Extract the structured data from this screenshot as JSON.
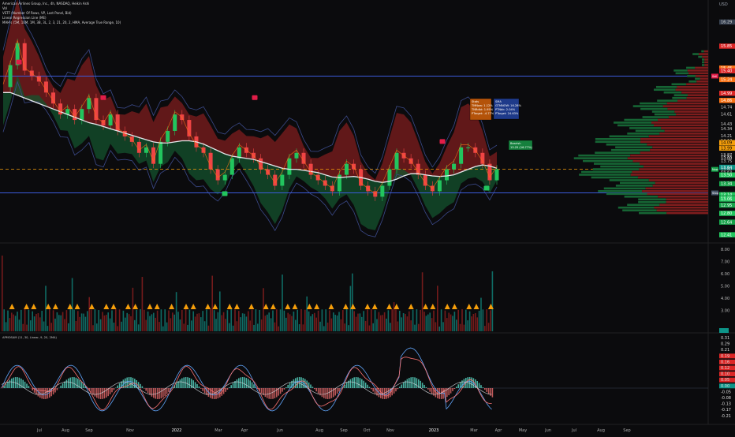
{
  "legend": {
    "title": "American Airlines Group, Inc., 4h, NASDAQ, Heikin Ashi",
    "line2": "Vol",
    "line3": "VSTF (Number Of Rows, VP, Last Panel, Bid)",
    "line4": "Linear Regression Line (ME)",
    "line5": "MAH's (5M, 10M, 1M, 3B, 3L, 2, 3, 21, 20, 2, HMA, Average True Range, 10)"
  },
  "currency": "USD",
  "colors": {
    "background": "#0b0b0d",
    "up": "#22c55e",
    "down": "#ef4444",
    "cloud_red": "#7f1d1d",
    "cloud_green": "#14532d",
    "price_marker": "#f59e0b",
    "level_line": "#3b5bdb",
    "wma": "#e5e7eb",
    "triangle": "#f59e0b",
    "osc_blue": "#60a5fa",
    "osc_red": "#f87171",
    "osc_white": "#d1d5db"
  },
  "annotations": {
    "box1": [
      "Stats",
      "TMNow: 1.12%",
      "TNRdbt: 1.95%",
      "PTarget: -4.77%"
    ],
    "box2": [
      "SMA",
      "GTMNOW: 16.28%",
      "PTNbk: 2.04%",
      "PTarget: 24.63%"
    ],
    "box3": [
      "Bearish",
      "13.25 (16.77%)"
    ],
    "sig_label": "Sell"
  },
  "volume_panel": {
    "labels": [
      "8.00",
      "7.00",
      "6.00",
      "5.00",
      "4.00",
      "3.00"
    ]
  },
  "osc_panel": {
    "title": "APMOSAM (11, 30, Linear, 9, 20, 2MA)"
  },
  "chart_data": {
    "type": "line",
    "title": "American Airlines Group, Inc., 4h, NASDAQ, Heikin Ashi",
    "x_ticks": [
      "Jul",
      "Aug",
      "Sep",
      "Nov",
      "2022",
      "Mar",
      "Apr",
      "Jun",
      "Aug",
      "Sep",
      "Oct",
      "Nov",
      "2023",
      "Mar",
      "Apr",
      "May",
      "Jun",
      "Jul",
      "Aug",
      "Sep"
    ],
    "x_months_index": [
      0,
      1,
      2,
      4,
      6,
      8,
      9,
      11,
      13,
      14,
      15,
      16,
      18,
      20,
      21,
      22,
      23,
      24,
      25,
      26
    ],
    "y_axis_labels": [
      "16.29",
      "15.85",
      "15.45",
      "15.40",
      "15.24",
      "14.99",
      "14.86",
      "14.74",
      "14.61",
      "14.43",
      "14.34",
      "14.21",
      "14.13",
      "14.09",
      "13.99",
      "13.87",
      "13.83",
      "13.80",
      "13.75",
      "13.64",
      "13.60",
      "13.54",
      "13.50",
      "13.34",
      "13.14",
      "13.09",
      "13.06",
      "12.95",
      "12.80",
      "12.64",
      "12.41"
    ],
    "ylim": [
      12.3,
      16.4
    ],
    "price": [
      15.1,
      15.5,
      15.9,
      15.4,
      15.3,
      15.2,
      15.0,
      14.8,
      14.6,
      14.7,
      14.5,
      14.7,
      14.9,
      14.5,
      14.4,
      14.6,
      14.3,
      14.2,
      14.1,
      13.9,
      14.0,
      13.7,
      14.1,
      14.3,
      14.6,
      14.5,
      14.2,
      14.0,
      13.9,
      13.6,
      13.4,
      13.5,
      13.8,
      14.0,
      13.9,
      13.8,
      13.6,
      13.5,
      13.3,
      13.5,
      13.8,
      13.9,
      13.7,
      13.5,
      13.4,
      13.3,
      13.2,
      13.5,
      13.7,
      13.6,
      13.3,
      13.2,
      13.1,
      13.3,
      13.6,
      13.9,
      13.8,
      13.7,
      13.5,
      13.3,
      13.2,
      13.4,
      13.6,
      13.7,
      14.0,
      14.0,
      13.9,
      13.7,
      13.4,
      13.6
    ],
    "wma": [
      15.0,
      15.0,
      14.95,
      14.9,
      14.85,
      14.8,
      14.75,
      14.7,
      14.65,
      14.6,
      14.55,
      14.5,
      14.45,
      14.42,
      14.38,
      14.34,
      14.3,
      14.26,
      14.22,
      14.18,
      14.14,
      14.1,
      14.08,
      14.08,
      14.1,
      14.12,
      14.12,
      14.1,
      14.06,
      14.0,
      13.94,
      13.88,
      13.84,
      13.82,
      13.8,
      13.78,
      13.74,
      13.7,
      13.66,
      13.62,
      13.6,
      13.6,
      13.58,
      13.56,
      13.54,
      13.5,
      13.46,
      13.45,
      13.46,
      13.47,
      13.45,
      13.42,
      13.38,
      13.36,
      13.38,
      13.42,
      13.48,
      13.52,
      13.52,
      13.5,
      13.48,
      13.47,
      13.48,
      13.5,
      13.55,
      13.6,
      13.65,
      13.68,
      13.66,
      13.62
    ],
    "levels": {
      "top_line": 15.3,
      "bottom_line": 13.17,
      "current_dash": 13.6
    },
    "marker_labels": {
      "top": "Sell",
      "current": "Now",
      "bottom": "Stop"
    }
  }
}
